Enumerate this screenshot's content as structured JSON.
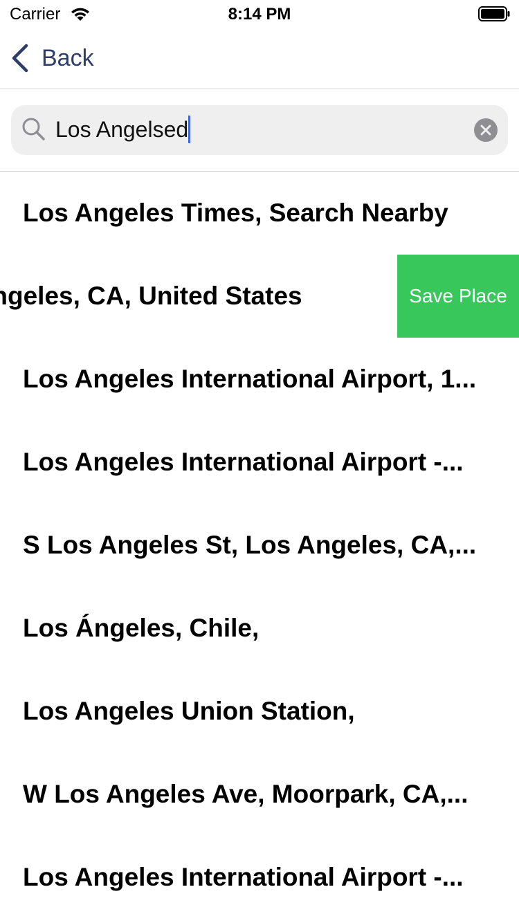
{
  "status_bar": {
    "carrier": "Carrier",
    "time": "8:14 PM"
  },
  "nav": {
    "back_label": "Back"
  },
  "search": {
    "value": "Los Angelsed"
  },
  "results": [
    {
      "label": "Los Angeles Times, Search Nearby"
    },
    {
      "label": "Los Angeles, CA, United States",
      "swipe_action": "Save Place"
    },
    {
      "label": "Los Angeles International Airport, 1..."
    },
    {
      "label": "Los Angeles International Airport -..."
    },
    {
      "label": "S Los Angeles St, Los Angeles, CA,..."
    },
    {
      "label": "Los Ángeles, Chile,"
    },
    {
      "label": "Los Angeles Union Station,"
    },
    {
      "label": "W Los Angeles Ave, Moorpark, CA,..."
    },
    {
      "label": "Los Angeles International Airport -..."
    }
  ],
  "colors": {
    "accent": "#2f3d6b",
    "save_action": "#37c75a",
    "caret": "#3d66e6"
  },
  "icons": [
    "wifi-icon",
    "battery-icon",
    "chevron-left-icon",
    "search-icon",
    "clear-icon"
  ]
}
